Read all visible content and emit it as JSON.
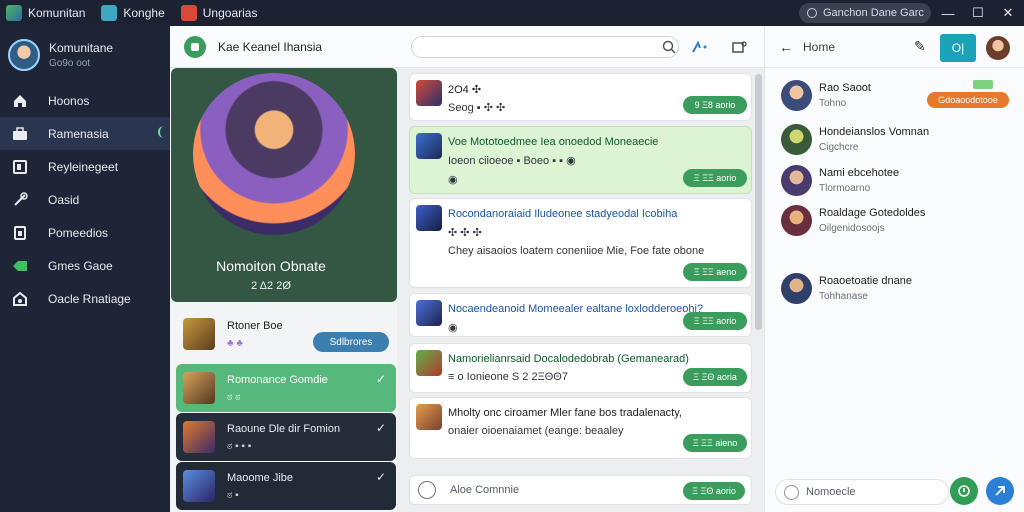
{
  "titlebar": {
    "tabs": [
      "Komunitan",
      "Konghe",
      "Ungoarias"
    ],
    "search_placeholder": "Ganchon Dane Garc",
    "controls": [
      "—",
      "☐",
      "✕"
    ]
  },
  "sidebar": {
    "profile_name": "Komunitane",
    "profile_sub": "Go9o oot",
    "items": [
      {
        "label": "Hoonos",
        "icon": "home-icon"
      },
      {
        "label": "Ramenasia",
        "icon": "briefcase-icon",
        "active": true
      },
      {
        "label": "Reyleinegeet",
        "icon": "square-icon"
      },
      {
        "label": "Oasid",
        "icon": "link-icon"
      },
      {
        "label": "Pomeedios",
        "icon": "document-icon"
      },
      {
        "label": "Gmes Gaoe",
        "icon": "green-tag-icon"
      },
      {
        "label": "Oacle Rnatiage",
        "icon": "gamepad-icon"
      }
    ]
  },
  "mid_header": {
    "title": "Kae Keanel Ihansia",
    "search_placeholder": ""
  },
  "feature": {
    "title": "Nomoiton Obnate",
    "sub": "2 Δ2 2Ø"
  },
  "left_list": [
    {
      "title": "Rtoner Boe",
      "sub": "♣ ♣",
      "button": "Sdlbrores"
    },
    {
      "title": "Romonance Gomdie",
      "sub": "ಠ ಠ"
    },
    {
      "title": "Raoune Dle dir Fomion",
      "sub": "ಠ ▪ ▪ ▪"
    },
    {
      "title": "Maoome Jibe",
      "sub": "ಠ ▪"
    }
  ],
  "cards": [
    {
      "t1": "2O4 ✣",
      "t2": "Seog ▪ ✣ ✣",
      "t3": "",
      "time": "9 Ξ8 aorio",
      "green": false
    },
    {
      "t1": "Voe Mototoedmee Iea onoedod Moneaecie",
      "t2": "Ioeon ciioeoe ▪ Boeo ▪ ▪ ◉",
      "t3": "◉",
      "time": "Ξ ΞΞ aorio",
      "green": true
    },
    {
      "t1": "Rocondanoraiaid Iludeonee stadyeodal Icobiha",
      "t2": "✣ ✣ ✣",
      "t3": "Chey aisaoios loatem coneniioe Mie, Foe fate obone",
      "time": "Ξ ΞΞ aeno",
      "green": false
    },
    {
      "t1": "Nocaendeanoid Momeealer ealtane loxlodderoeohi?",
      "t2": "◉",
      "t3": "",
      "time": "Ξ ΞΞ aorio",
      "green": false
    },
    {
      "t1": "Namorielianrsaid Docalodedobrab (Gemanearad)",
      "t2": "≡ o Ionieone S 2 2ΞΘΘ7",
      "t3": "",
      "time": "Ξ ΞΘ aoria",
      "green": false
    },
    {
      "t1": "Mholty onc ciroamer Mler fane bos tradalenacty,",
      "t2": "onaier oioenaiamet (eange: beaaley",
      "t3": "",
      "time": "Ξ ΞΞ aieno",
      "green": false
    }
  ],
  "composer": {
    "placeholder": "Aloe Comnnie",
    "send": "Ξ ΞΘ aorio"
  },
  "right_panel": {
    "home_label": "Home",
    "button_label": "O|",
    "items": [
      {
        "title": "Rao Saoot",
        "sub": "Tohno",
        "badge": "Gdoaoodotooe"
      },
      {
        "title": "Hondeianslos Vomnan",
        "sub": "Cigchcre"
      },
      {
        "title": "Nami ebcehotee",
        "sub": "Tlormoarno"
      },
      {
        "title": "Roaldage Gotedoldes",
        "sub": "Oilgenidosoojs"
      },
      {
        "title": "Roaoetoatie dnane",
        "sub": "Tohhanase"
      }
    ],
    "composer_placeholder": "Nomoecle"
  },
  "colors": {
    "sidebar": "#1e2536",
    "accent_green": "#3a9d5d",
    "teal": "#1aa3b8",
    "orange": "#e8782b"
  }
}
